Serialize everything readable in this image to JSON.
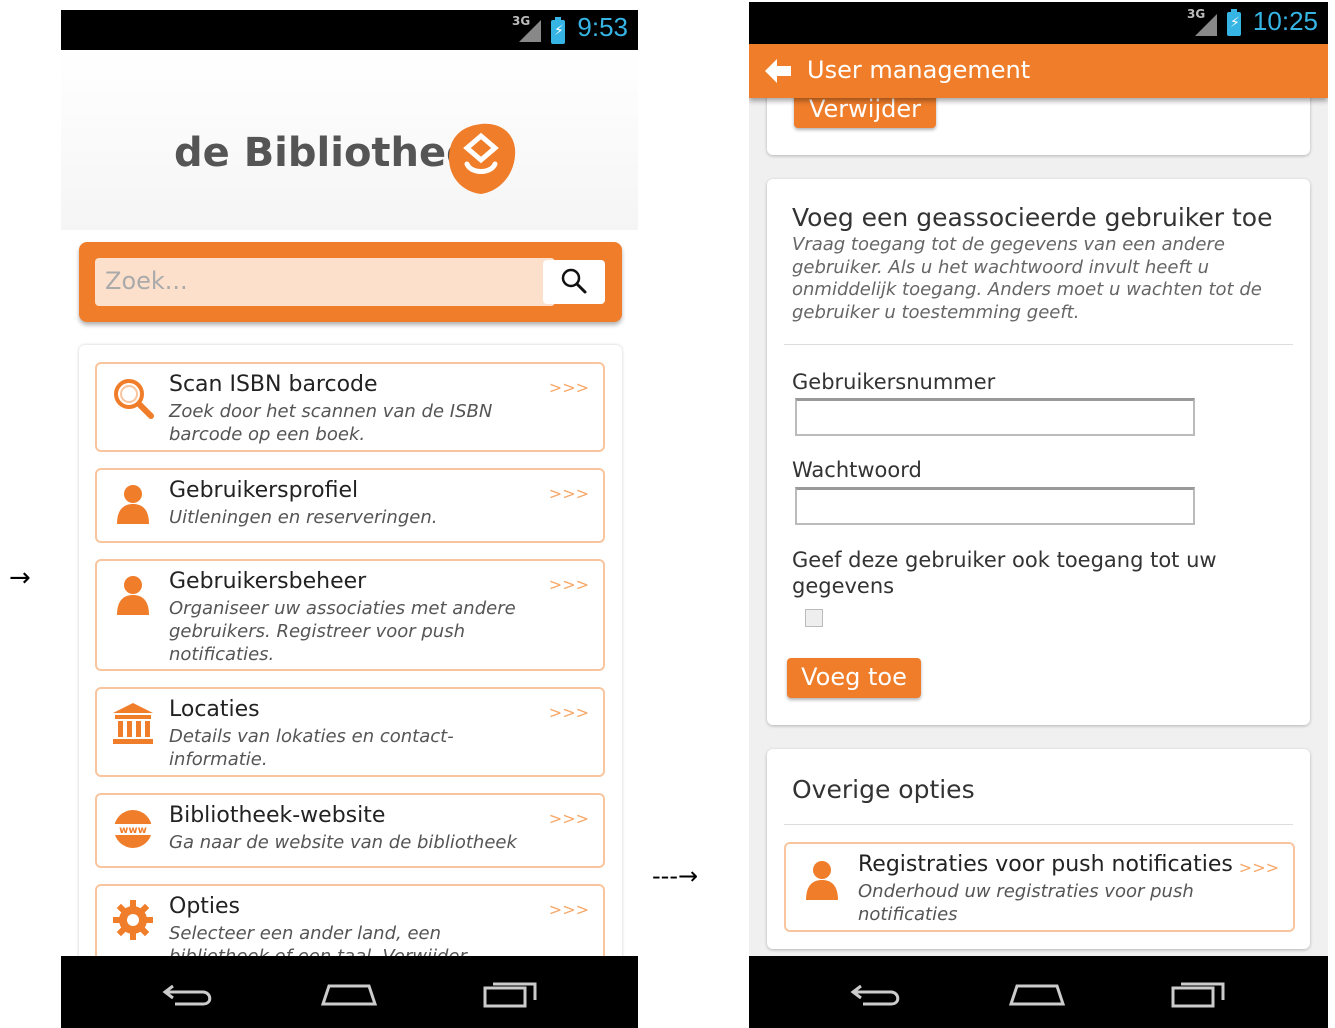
{
  "arrow_main": "→",
  "arrow_dashed": "---→",
  "screen1": {
    "status": {
      "network": "3G",
      "time": "9:53"
    },
    "logo": "de Bibliotheek",
    "search": {
      "placeholder": "Zoek..."
    },
    "items": [
      {
        "title": "Scan ISBN barcode",
        "desc": "Zoek door het scannen van de ISBN barcode op een boek.",
        "arrows": ">>>",
        "icon": "magnifier-icon"
      },
      {
        "title": "Gebruikersprofiel",
        "desc": "Uitleningen en reserveringen.",
        "arrows": ">>>",
        "icon": "user-icon"
      },
      {
        "title": "Gebruikersbeheer",
        "desc": "Organiseer uw associaties met andere gebruikers. Registreer voor push notificaties.",
        "arrows": ">>>",
        "icon": "user-icon"
      },
      {
        "title": "Locaties",
        "desc": "Details van lokaties en contact-informatie.",
        "arrows": ">>>",
        "icon": "library-building-icon"
      },
      {
        "title": "Bibliotheek-website",
        "desc": "Ga naar de website van de bibliotheek",
        "arrows": ">>>",
        "icon": "www-globe-icon"
      },
      {
        "title": "Opties",
        "desc": "Selecteer een ander land, een bibliotheek of een taal. Verwijder persoonlijke",
        "arrows": ">>>",
        "icon": "gear-icon"
      }
    ]
  },
  "screen2": {
    "status": {
      "network": "3G",
      "time": "10:25"
    },
    "appbar_title": "User management",
    "remove_button": "Verwijder",
    "add_card": {
      "heading": "Voeg een geassocieerde gebruiker toe",
      "description": "Vraag toegang tot de gegevens van een andere gebruiker. Als u het wachtwoord invult heeft u onmiddelijk toegang. Anders moet u wachten tot de gebruiker u toestemming geeft.",
      "user_number_label": "Gebruikersnummer",
      "user_number_value": "",
      "password_label": "Wachtwoord",
      "password_value": "",
      "grant_label": "Geef deze gebruiker ook toegang tot uw gegevens",
      "grant_checked": false,
      "add_button": "Voeg toe"
    },
    "other_card": {
      "heading": "Overige opties",
      "item": {
        "title": "Registraties voor push notificaties",
        "desc": "Onderhoud uw registraties voor push notificaties",
        "arrows": ">>>",
        "icon": "user-icon"
      }
    }
  },
  "colors": {
    "accent": "#f07d2a",
    "status_blue": "#36b5e5",
    "item_border": "#f9c59e"
  }
}
